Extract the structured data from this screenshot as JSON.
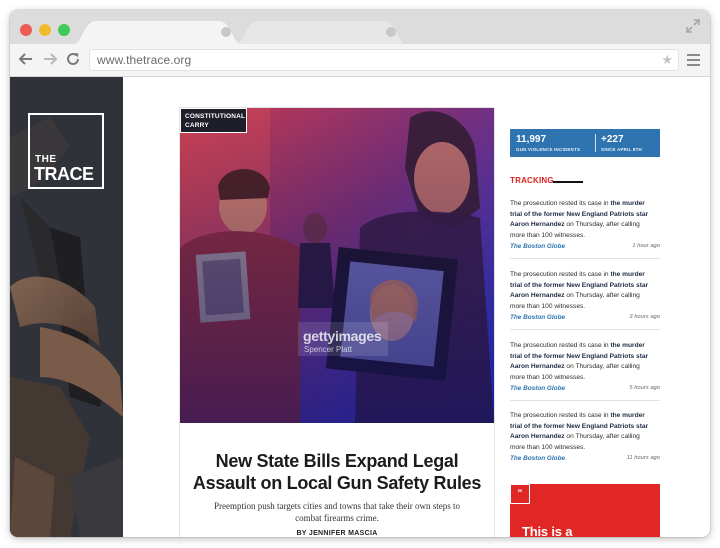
{
  "browser": {
    "url": "www.thetrace.org",
    "colors": {
      "close": "#ee5d55",
      "minimize": "#f2bb2f",
      "maximize": "#3fca58"
    }
  },
  "site": {
    "logo_line1": "THE",
    "logo_line2": "TRACE"
  },
  "article": {
    "tag_line1": "CONSTITUTIONAL",
    "tag_line2": "CARRY",
    "image_watermark": "gettyimages",
    "image_credit": "Spencer Platt",
    "headline_line1": "New State Bills Expand Legal",
    "headline_line2": "Assault on Local Gun Safety Rules",
    "dek_line1": "Preemption push targets cities and towns that take their own steps to",
    "dek_line2": "combat firearms crime.",
    "byline": "BY JENNIFER MASCIA"
  },
  "stats": {
    "incidents_value": "11,997",
    "incidents_label": "GUN VIOLENCE INCIDENTS",
    "since_value": "+227",
    "since_label": "SINCE APRIL 8TH"
  },
  "tracking": {
    "heading": "TRACKING",
    "items": [
      {
        "text_a": "The prosecution rested its case in ",
        "bold_a": "the murder",
        "bold_b": "trial of the former New England Patriots star",
        "bold_c": "Aaron Hernandez",
        "text_b": " on Thursday, after calling",
        "text_c": "more than 100 witnesses.",
        "source": "The Boston Globe",
        "time": "1 hour ago"
      },
      {
        "text_a": "The prosecution rested its case in ",
        "bold_a": "the murder",
        "bold_b": "trial of the former New England Patriots star",
        "bold_c": "Aaron Hernandez",
        "text_b": " on Thursday, after calling",
        "text_c": "more than 100 witnesses.",
        "source": "The Boston Globe",
        "time": "3 hours ago"
      },
      {
        "text_a": "The prosecution rested its case in ",
        "bold_a": "the murder",
        "bold_b": "trial of the former New England Patriots star",
        "bold_c": "Aaron Hernandez",
        "text_b": " on Thursday, after calling",
        "text_c": "more than 100 witnesses.",
        "source": "The Boston Globe",
        "time": "5 hours ago"
      },
      {
        "text_a": "The prosecution rested its case in ",
        "bold_a": "the murder",
        "bold_b": "trial of the former New England Patriots star",
        "bold_c": "Aaron Hernandez",
        "text_b": " on Thursday, after calling",
        "text_c": "more than 100 witnesses.",
        "source": "The Boston Globe",
        "time": "11 hours ago"
      }
    ]
  },
  "quote_box": {
    "quote_mark": "“",
    "text": "This is a"
  }
}
